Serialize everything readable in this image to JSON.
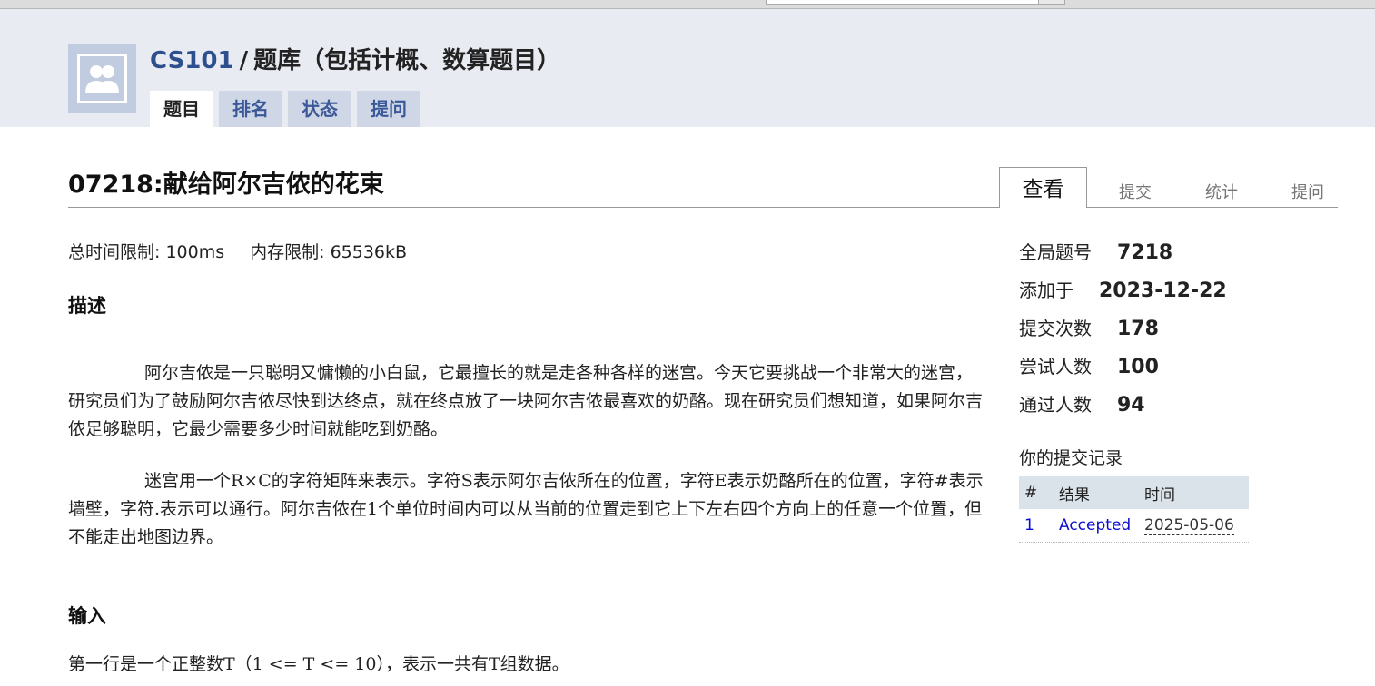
{
  "header": {
    "course": "CS101",
    "separator": "/",
    "bank_title": "题库（包括计概、数算题目）",
    "nav": [
      "题目",
      "排名",
      "状态",
      "提问"
    ]
  },
  "problem": {
    "title": "07218:献给阿尔吉侬的花束",
    "tabs": [
      "查看",
      "提交",
      "统计",
      "提问"
    ],
    "time_limit": "总时间限制: 100ms",
    "memory_limit": "内存限制: 65536kB",
    "desc_heading": "描述",
    "desc_p1": "阿尔吉侬是一只聪明又慵懒的小白鼠，它最擅长的就是走各种各样的迷宫。今天它要挑战一个非常大的迷宫，研究员们为了鼓励阿尔吉侬尽快到达终点，就在终点放了一块阿尔吉侬最喜欢的奶酪。现在研究员们想知道，如果阿尔吉侬足够聪明，它最少需要多少时间就能吃到奶酪。",
    "desc_p2": "迷宫用一个R×C的字符矩阵来表示。字符S表示阿尔吉侬所在的位置，字符E表示奶酪所在的位置，字符#表示墙壁，字符.表示可以通行。阿尔吉侬在1个单位时间内可以从当前的位置走到它上下左右四个方向上的任意一个位置，但不能走出地图边界。",
    "input_heading": "输入",
    "input_p1": "第一行是一个正整数T（1 <= T <= 10），表示一共有T组数据。"
  },
  "sidebar": {
    "info": [
      {
        "label": "全局题号",
        "value": "7218"
      },
      {
        "label": "添加于",
        "value": "2023-12-22"
      },
      {
        "label": "提交次数",
        "value": "178"
      },
      {
        "label": "尝试人数",
        "value": "100"
      },
      {
        "label": "通过人数",
        "value": "94"
      }
    ],
    "submissions_title": "你的提交记录",
    "columns": [
      "#",
      "结果",
      "时间"
    ],
    "rows": [
      {
        "num": "1",
        "result": "Accepted",
        "time": "2025-05-06"
      }
    ]
  },
  "colors": {
    "accent": "#2d4f8e",
    "header_bg": "#e9ebf2",
    "tab_bg": "#cfd6e6",
    "accepted": "#0b0ccf"
  },
  "icons": [
    "user-group-icon"
  ]
}
